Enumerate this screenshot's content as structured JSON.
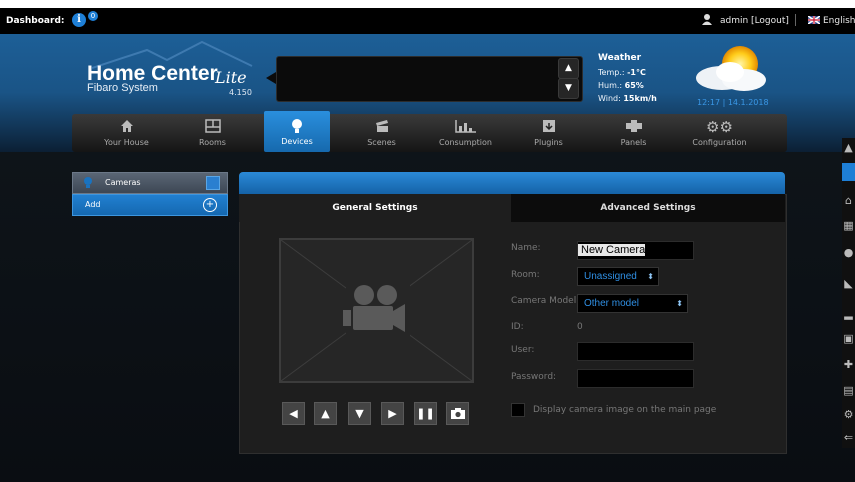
{
  "topbar": {
    "dashboard_label": "Dashboard:",
    "user_text": "admin [Logout]",
    "language": "English"
  },
  "logo": {
    "title": "Home Center",
    "subtitle": "Fibaro System",
    "edition": "Lite",
    "version": "4.150"
  },
  "weather": {
    "title": "Weather",
    "temp_label": "Temp.:",
    "temp_value": "-1°C",
    "hum_label": "Hum.:",
    "hum_value": "65%",
    "wind_label": "Wind:",
    "wind_value": "15km/h",
    "datetime": "12:17 | 14.1.2018"
  },
  "nav": {
    "items": [
      {
        "label": "Your House",
        "icon": "house-icon"
      },
      {
        "label": "Rooms",
        "icon": "rooms-icon"
      },
      {
        "label": "Devices",
        "icon": "lightbulb-icon"
      },
      {
        "label": "Scenes",
        "icon": "scenes-icon"
      },
      {
        "label": "Consumption",
        "icon": "chart-icon"
      },
      {
        "label": "Plugins",
        "icon": "plugin-icon"
      },
      {
        "label": "Panels",
        "icon": "panels-icon"
      },
      {
        "label": "Configuration",
        "icon": "gears-icon"
      }
    ],
    "active": "Devices"
  },
  "sidebar": {
    "section": "Cameras",
    "add_label": "Add"
  },
  "tabs": {
    "general": "General Settings",
    "advanced": "Advanced Settings"
  },
  "form": {
    "name_label": "Name:",
    "name_value": "New Camera",
    "room_label": "Room:",
    "room_value": "Unassigned",
    "model_label": "Camera Model:",
    "model_value": "Other model",
    "id_label": "ID:",
    "id_value": "0",
    "user_label": "User:",
    "user_value": "",
    "password_label": "Password:",
    "password_value": "",
    "display_checkbox_label": "Display camera image on the main page"
  },
  "colors": {
    "accent": "#1a73c0",
    "header": "#1d5f97",
    "select_text": "#2f8ee2"
  }
}
